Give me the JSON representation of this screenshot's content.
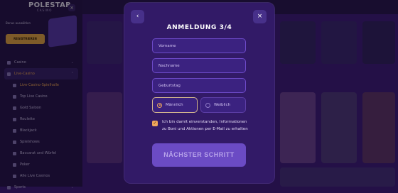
{
  "sidebar": {
    "logo": "POLESTAR",
    "logo_sub": "CASINO",
    "close_glyph": "×",
    "promo_title": "Bonus auswählen",
    "promo_button": "REGISTRIEREN",
    "items": [
      {
        "label": "Casino",
        "icon": "casino-icon",
        "chevron": "⌄"
      },
      {
        "label": "Live-Casino",
        "icon": "live-casino-icon",
        "chevron": "⌃"
      },
      {
        "label": "Live-Casino-Spielhalle",
        "icon": "person-icon"
      },
      {
        "label": "Top Live Casino",
        "icon": "crown-icon"
      },
      {
        "label": "Gold Saloon",
        "icon": "gold-icon"
      },
      {
        "label": "Roulette",
        "icon": "roulette-icon"
      },
      {
        "label": "Blackjack",
        "icon": "cards-icon"
      },
      {
        "label": "Spielshows",
        "icon": "show-icon"
      },
      {
        "label": "Baccarat und Würfel",
        "icon": "dice-icon"
      },
      {
        "label": "Poker",
        "icon": "poker-icon"
      },
      {
        "label": "Alle Live Casinos",
        "icon": "grid-icon"
      },
      {
        "label": "Sports",
        "icon": "sports-icon",
        "chevron": "⌄"
      }
    ]
  },
  "modal": {
    "back_glyph": "‹",
    "close_glyph": "×",
    "title": "ANMELDUNG 3/4",
    "fields": {
      "first_name_placeholder": "Vorname",
      "last_name_placeholder": "Nachname",
      "birthday_placeholder": "Geburtstag"
    },
    "gender": {
      "male": "Männlich",
      "female": "Weiblich",
      "selected": "Männlich"
    },
    "consent": {
      "checked": true,
      "check_glyph": "✓",
      "text": "Ich bin damit einverstanden, Informationen zu Boni und Aktionen per E-Mail zu erhalten"
    },
    "next_button": "NÄCHSTER SCHRITT"
  },
  "colors": {
    "background": "#241047",
    "modal": "#321a67",
    "accent": "#f0a75b",
    "field_border": "#6d4ac8",
    "button": "#6b4bc4"
  }
}
